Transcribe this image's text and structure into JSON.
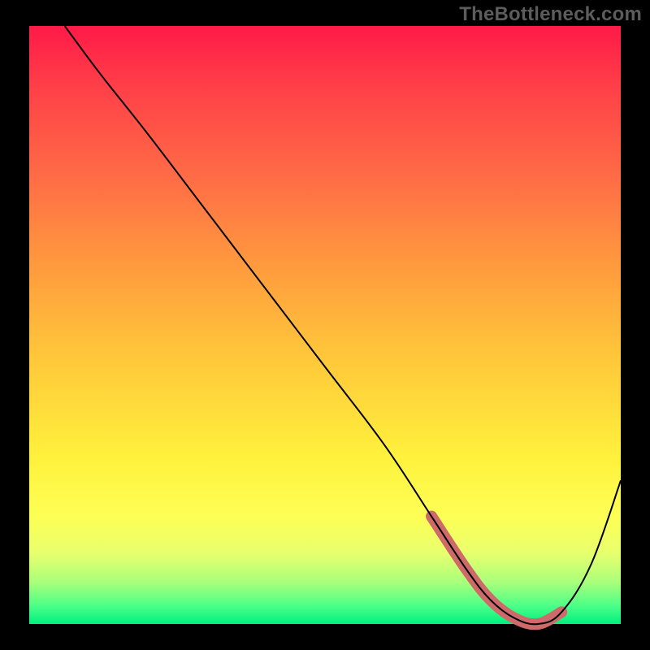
{
  "watermark": "TheBottleneck.com",
  "chart_data": {
    "type": "line",
    "title": "",
    "xlabel": "",
    "ylabel": "",
    "xlim": [
      0,
      100
    ],
    "ylim": [
      0,
      100
    ],
    "background_gradient": {
      "top_color": "#ff1a47",
      "mid_color": "#fff13c",
      "bottom_color": "#00f07f"
    },
    "series": [
      {
        "name": "bottleneck-curve",
        "color": "#000000",
        "x": [
          6,
          12,
          20,
          30,
          40,
          50,
          60,
          68,
          74,
          78,
          82,
          86,
          90,
          95,
          100
        ],
        "values": [
          100,
          92,
          82,
          69,
          56,
          43,
          30,
          18,
          9,
          4,
          1,
          0,
          2,
          10,
          24
        ]
      }
    ],
    "highlight_band": {
      "name": "optimal-range",
      "color": "#cf6a6a",
      "x": [
        68,
        74,
        78,
        82,
        86,
        90
      ],
      "values": [
        18,
        9,
        4,
        1,
        0,
        2
      ]
    }
  }
}
